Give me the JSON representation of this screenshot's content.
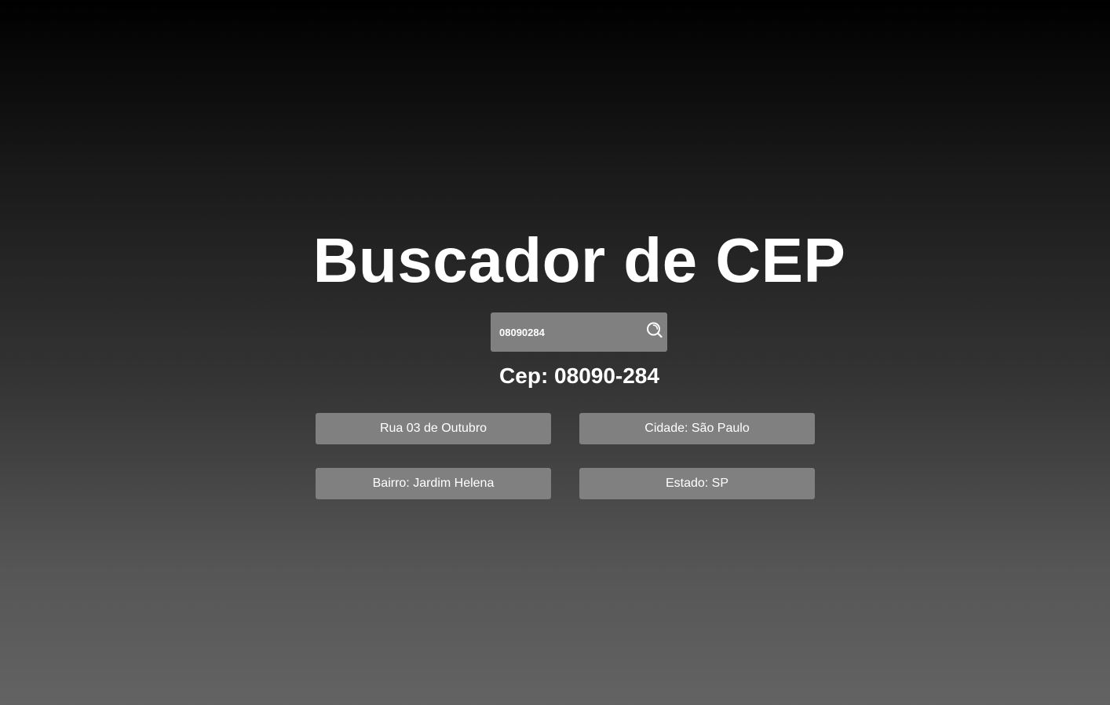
{
  "header": {
    "title": "Buscador de CEP"
  },
  "search": {
    "value": "08090284",
    "placeholder": "",
    "icon": "search-icon"
  },
  "result": {
    "cep_label": "Cep: 08090-284",
    "rua": "Rua 03 de Outubro",
    "cidade": "Cidade: São Paulo",
    "bairro": "Bairro: Jardim Helena",
    "estado": "Estado: SP"
  },
  "colors": {
    "background_top": "#000000",
    "background_bottom": "#636363",
    "panel": "#808080",
    "text": "#ffffff"
  }
}
